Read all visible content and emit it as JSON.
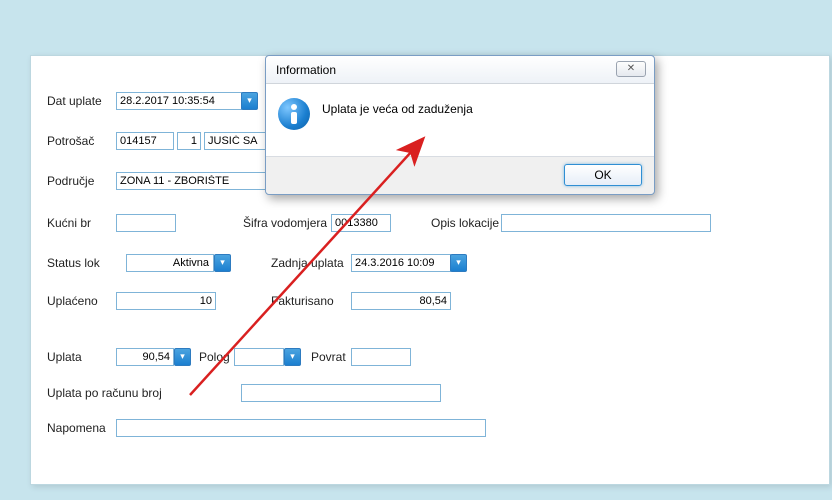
{
  "form": {
    "dat_uplate": {
      "label": "Dat uplate",
      "value": "28.2.2017 10:35:54"
    },
    "potrosac": {
      "label": "Potrošač",
      "code": "014157",
      "seq": "1",
      "name": "JUSIĆ SA"
    },
    "podrucje": {
      "label": "Područje",
      "value": "ZONA 11 - ZBORIŠTE"
    },
    "kucni_br": {
      "label": "Kućni br",
      "value": ""
    },
    "sifra_vodomjera": {
      "label": "Šifra vodomjera",
      "value": "0013380"
    },
    "opis_lokacije": {
      "label": "Opis lokacije",
      "value": ""
    },
    "status_lok": {
      "label": "Status lok",
      "value": "Aktivna"
    },
    "zadnja_uplata": {
      "label": "Zadnja uplata",
      "value": "24.3.2016 10:09"
    },
    "uplaceno": {
      "label": "Uplaćeno",
      "value": "10"
    },
    "fakturisano": {
      "label": "Fakturisano",
      "value": "80,54"
    },
    "uplata": {
      "label": "Uplata",
      "value": "90,54"
    },
    "polog": {
      "label": "Polog",
      "value": ""
    },
    "povrat": {
      "label": "Povrat",
      "value": ""
    },
    "uplata_po_racunu": {
      "label": "Uplata po računu broj",
      "value": ""
    },
    "napomena": {
      "label": "Napomena",
      "value": ""
    }
  },
  "dialog": {
    "title": "Information",
    "message": "Uplata je veća od zaduženja",
    "ok": "OK",
    "close": "✕"
  }
}
